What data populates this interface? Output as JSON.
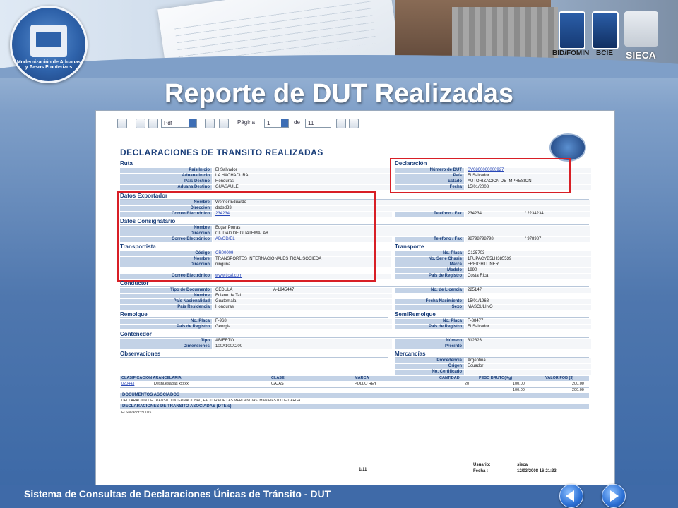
{
  "slide": {
    "title": "Reporte de DUT Realizadas",
    "footer": "Sistema de Consultas de Declaraciones Únicas de Tránsito - DUT",
    "logo_text": "Modernización de Aduanas y Pasos Fronterizos",
    "sponsors": [
      "BID/FOMIN",
      "BCIE",
      "SIECA"
    ]
  },
  "toolbar": {
    "format": "Pdf",
    "page_label": "Página",
    "page": "1",
    "of_label": "de",
    "total_pages": "11"
  },
  "doc": {
    "heading": "DECLARACIONES DE TRANSITO REALIZADAS",
    "ruta": {
      "title": "Ruta",
      "rows": [
        {
          "label": "País Inicio",
          "value": "El Salvador"
        },
        {
          "label": "Aduana Inicio",
          "value": "LA HACHADURA"
        },
        {
          "label": "País Destino",
          "value": "Honduras"
        },
        {
          "label": "Aduana Destino",
          "value": "GUASAULE"
        }
      ]
    },
    "declaracion": {
      "title": "Declaración",
      "rows": [
        {
          "label": "Número de DUT",
          "value": "SV0800000000927"
        },
        {
          "label": "País",
          "value": "El Salvador"
        },
        {
          "label": "Estado",
          "value": "AUTORIZACION DE IMPRESION"
        },
        {
          "label": "Fecha",
          "value": "15/01/2008"
        }
      ]
    },
    "exportador": {
      "title": "Datos Exportador",
      "nombre_label": "Nombre",
      "nombre": "Werner Eduardo",
      "direccion_label": "Dirección",
      "direccion": "dsdsd33",
      "correo_label": "Correo Electrónico",
      "correo": "234234",
      "tel_label": "Teléfono / Fax",
      "tel": "234234",
      "fax": "/ 2234234"
    },
    "consignatario": {
      "title": "Datos Consignatario",
      "nombre_label": "Nombre",
      "nombre": "Edgar Porras",
      "direccion_label": "Dirección",
      "direccion": "CIUDAD DE GUATEMALA8",
      "correo_label": "Correo Electrónico",
      "correo": "AB/OD/EL",
      "tel_label": "Teléfono / Fax",
      "tel": "98798798798",
      "fax": "/ 978987"
    },
    "transportista": {
      "title": "Transportista",
      "codigo_label": "Código",
      "codigo": "CR00009",
      "nombre_label": "Nombre",
      "nombre": "TRANSPORTES INTERNACIONALES TICAL SOCIEDA",
      "direccion_label": "Dirección",
      "direccion": "ninguna",
      "correo_label": "Correo Electrónico",
      "correo": "www.tical.com"
    },
    "transporte": {
      "title": "Transporte",
      "rows": [
        {
          "label": "No. Placa",
          "value": "C125703"
        },
        {
          "label": "No. Serie Chasis",
          "value": "1FUPACYB5LH385539"
        },
        {
          "label": "Marca",
          "value": "FREIGHTLINER"
        },
        {
          "label": "Modelo",
          "value": "1990"
        },
        {
          "label": "País de Registro",
          "value": "Costa Rica"
        }
      ]
    },
    "conductor": {
      "title": "Conductor",
      "tipo_label": "Tipo de Documento",
      "tipo": "CEDULA",
      "doc_num": "A-1945447",
      "nombre_label": "Nombre",
      "nombre": "Fulano de Tal",
      "nacionalidad_label": "País Nacionalidad",
      "nacionalidad": "Guatemala",
      "residencia_label": "País Residencia",
      "residencia": "Honduras",
      "licencia_label": "No. de Licencia",
      "licencia": "225147",
      "nacimiento_label": "Fecha Nacimiento",
      "nacimiento": "15/01/1968",
      "sexo_label": "Sexo",
      "sexo": "MASCULINO"
    },
    "remolque": {
      "title": "Remolque",
      "placa_label": "No. Placa",
      "placa": "F-968",
      "pais_label": "País de Registro",
      "pais": "Georgia"
    },
    "semiremolque": {
      "title": "SemiRemolque",
      "placa_label": "No. Placa",
      "placa": "F-88477",
      "pais_label": "País de Registro",
      "pais": "El Salvador"
    },
    "contenedor": {
      "title": "Contenedor",
      "tipo_label": "Tipo",
      "tipo": "ABIERTO",
      "dim_label": "Dimensiones",
      "dim": "100X100X200",
      "numero_label": "Número",
      "numero": "312323",
      "precinto_label": "Precinto",
      "precinto": ""
    },
    "observaciones": {
      "title": "Observaciones"
    },
    "mercancias": {
      "title": "Mercancías",
      "procedencia_label": "Procedencia",
      "procedencia": "Argentina",
      "origen_label": "Origen",
      "origen": "Ecuador",
      "cert_label": "No. Certificado",
      "cert": ""
    },
    "table": {
      "headers": [
        "CLASIFICACION ARANCELARIA",
        "CLASE",
        "MARCA",
        "CANTIDAD",
        "PESO BRUTO(Kg)",
        "VALOR FOB ($)"
      ],
      "row": [
        "020443",
        "Deshuesadas xxxxx",
        "CAJAS",
        "POLLO REY",
        "20",
        "100.00",
        "200.00"
      ],
      "totals": [
        "100.00",
        "200.00"
      ]
    },
    "documentos": {
      "title": "DOCUMENTOS ASOCIADOS",
      "text": "DECLARACION DE TRANSITO INTERNACIONAL, FACTURA DE LAS MERCANCIAS, MANIFIESTO DE CARGA"
    },
    "asociadas": {
      "title": "DECLARACIONES DE TRANSITO ASOCIADAS (DTE's)",
      "text": "El Salvador: 50015"
    },
    "footer": {
      "page": "1/11",
      "usuario_label": "Usuario:",
      "usuario": "sieca",
      "fecha_label": "Fecha   :",
      "fecha": "12/03/2008 16:21:33"
    }
  }
}
